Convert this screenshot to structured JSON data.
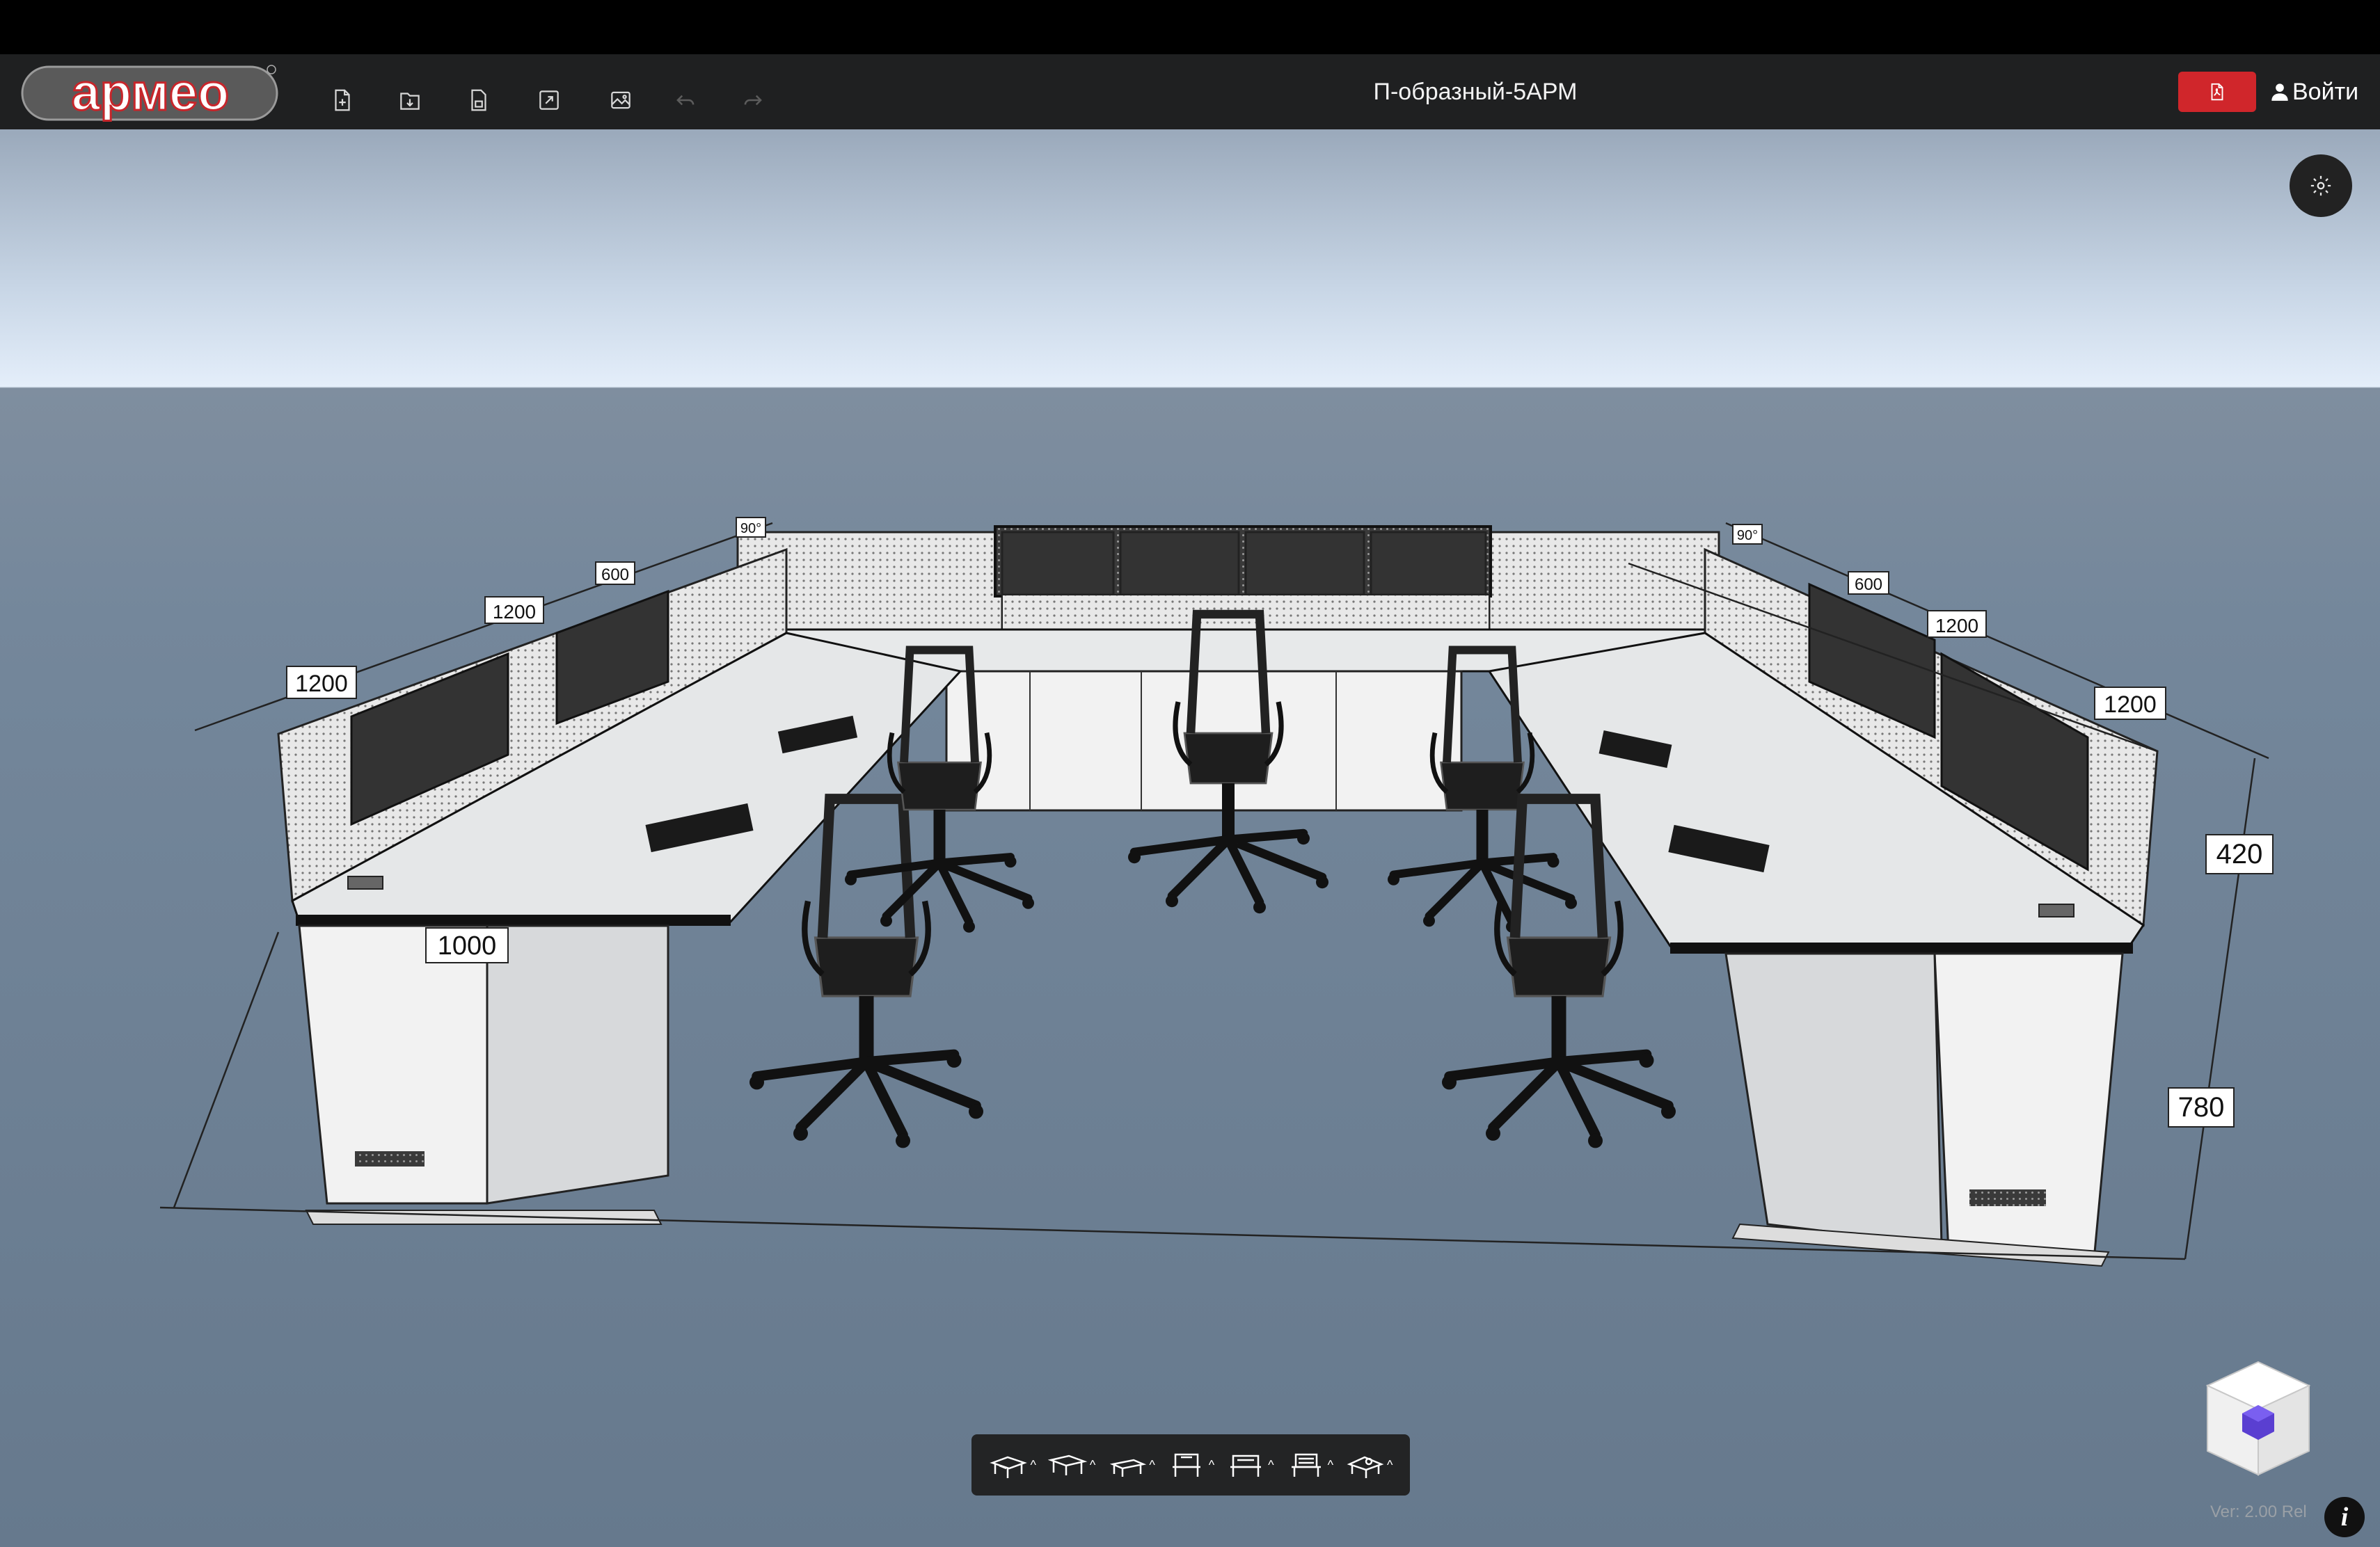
{
  "app": {
    "logo_text": "армео",
    "title": "П-образный-5АРМ",
    "login_label": "Войти",
    "version": "Ver: 2.00 Rel"
  },
  "toolbar_icons": [
    "new-file-icon",
    "open-folder-icon",
    "save-icon",
    "fullscreen-icon",
    "image-export-icon",
    "undo-icon",
    "redo-icon"
  ],
  "pdf_button": {
    "icon": "pdf-icon",
    "color": "#d0262b"
  },
  "scene": {
    "dimensions": {
      "left_front": "1200",
      "left_mid": "1200",
      "left_small": "600",
      "left_angle": "90°",
      "right_angle": "90°",
      "right_small": "600",
      "right_mid": "1200",
      "right_front": "1200",
      "depth": "1000",
      "panel_height": "420",
      "desk_height": "780"
    }
  },
  "view_modes": [
    {
      "name": "view-mode-1-icon"
    },
    {
      "name": "view-mode-2-icon"
    },
    {
      "name": "view-mode-3-icon"
    },
    {
      "name": "view-mode-4-icon"
    },
    {
      "name": "view-mode-5-icon"
    },
    {
      "name": "view-mode-6-icon"
    },
    {
      "name": "view-mode-7-icon"
    }
  ],
  "colors": {
    "toolbar": "#1f2021",
    "floor": "#6b7e92",
    "accent_red": "#d0262b",
    "cube_purple": "#5a3fd1"
  }
}
